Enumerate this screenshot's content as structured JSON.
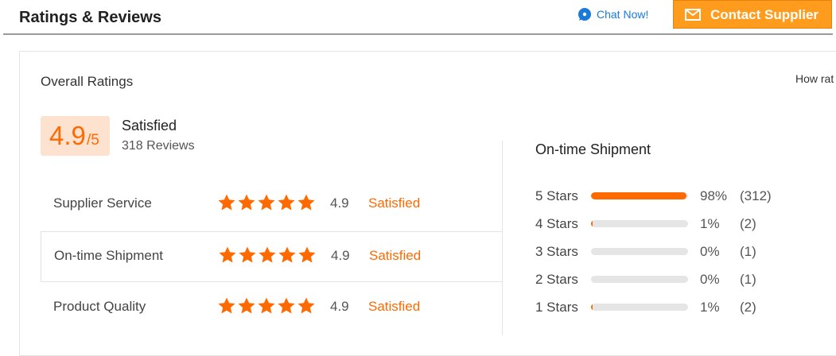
{
  "header": {
    "title": "Ratings & Reviews",
    "chat_label": "Chat Now!",
    "contact_label": "Contact Supplier"
  },
  "overall": {
    "title": "Overall Ratings",
    "how_rated": "How rat",
    "score": "4.9",
    "score_max": "/5",
    "satisfaction": "Satisfied",
    "reviews": "318 Reviews"
  },
  "categories": [
    {
      "label": "Supplier Service",
      "stars": 5,
      "score": "4.9",
      "satisfaction": "Satisfied"
    },
    {
      "label": "On-time Shipment",
      "stars": 5,
      "score": "4.9",
      "satisfaction": "Satisfied"
    },
    {
      "label": "Product Quality",
      "stars": 5,
      "score": "4.9",
      "satisfaction": "Satisfied"
    }
  ],
  "distribution": {
    "title": "On-time Shipment",
    "rows": [
      {
        "label": "5  Stars",
        "percent_value": 98,
        "percent": "98%",
        "count": "(312)"
      },
      {
        "label": "4  Stars",
        "percent_value": 1,
        "percent": "1%",
        "count": "(2)"
      },
      {
        "label": "3  Stars",
        "percent_value": 0,
        "percent": "0%",
        "count": "(1)"
      },
      {
        "label": "2  Stars",
        "percent_value": 0,
        "percent": "0%",
        "count": "(1)"
      },
      {
        "label": "1  Stars",
        "percent_value": 1,
        "percent": "1%",
        "count": "(2)"
      }
    ]
  },
  "colors": {
    "accent": "#ff6a00",
    "button": "#ff9b1d",
    "link": "#1a7ad9",
    "score_bg": "#fde2cf"
  }
}
